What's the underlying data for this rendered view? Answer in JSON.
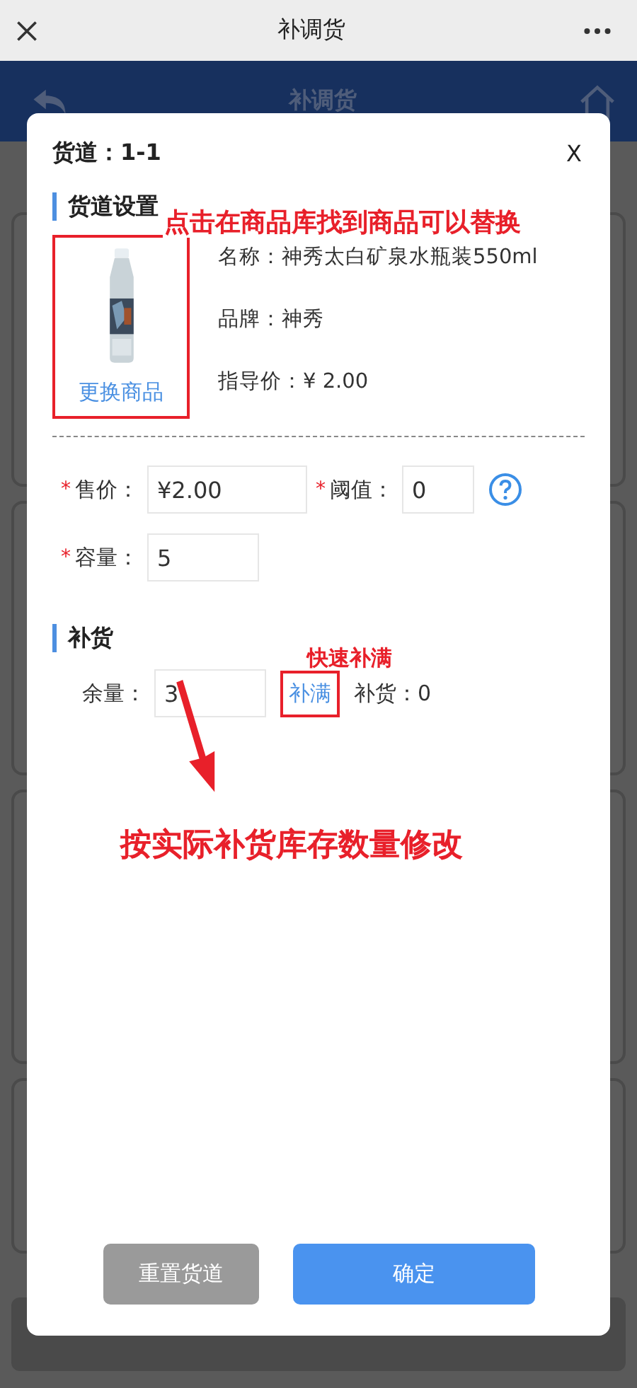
{
  "app_bar": {
    "title": "补调货"
  },
  "header": {
    "title": "补调货"
  },
  "dialog": {
    "lane_label": "货道：",
    "lane": "1-1",
    "close": "X",
    "settings_section": "货道设置",
    "product": {
      "change_link": "更换商品",
      "name_label": "名称：",
      "name": "神秀太白矿泉水瓶装550ml",
      "brand_label": "品牌：",
      "brand": "神秀",
      "guide_price_label": "指导价：",
      "guide_price": "¥ 2.00"
    },
    "field_rows": [
      [
        {
          "required_mark": "*",
          "label": "售价：",
          "value": "¥2.00",
          "kind": "wide"
        },
        {
          "required_mark": "*",
          "label": "阈值：",
          "value": "0",
          "help": true,
          "kind": "narrow"
        }
      ],
      [
        {
          "required_mark": "*",
          "label": "容量：",
          "value": "5",
          "kind": "medium"
        }
      ]
    ],
    "restock_section": "补货",
    "remaining_label": "余量：",
    "remaining": "3",
    "fill_link": "补满",
    "restock_label": "补货：",
    "restock": "0",
    "buttons": [
      {
        "label": "重置货道",
        "kind": "secondary"
      },
      {
        "label": "确定",
        "kind": "primary"
      }
    ]
  },
  "annotations": [
    {
      "text": "点击在商品库找到商品可以替换",
      "kind": "replace"
    },
    {
      "text": "快速补满",
      "kind": "fill"
    },
    {
      "text": "按实际补货库存数量修改",
      "kind": "edit"
    }
  ]
}
